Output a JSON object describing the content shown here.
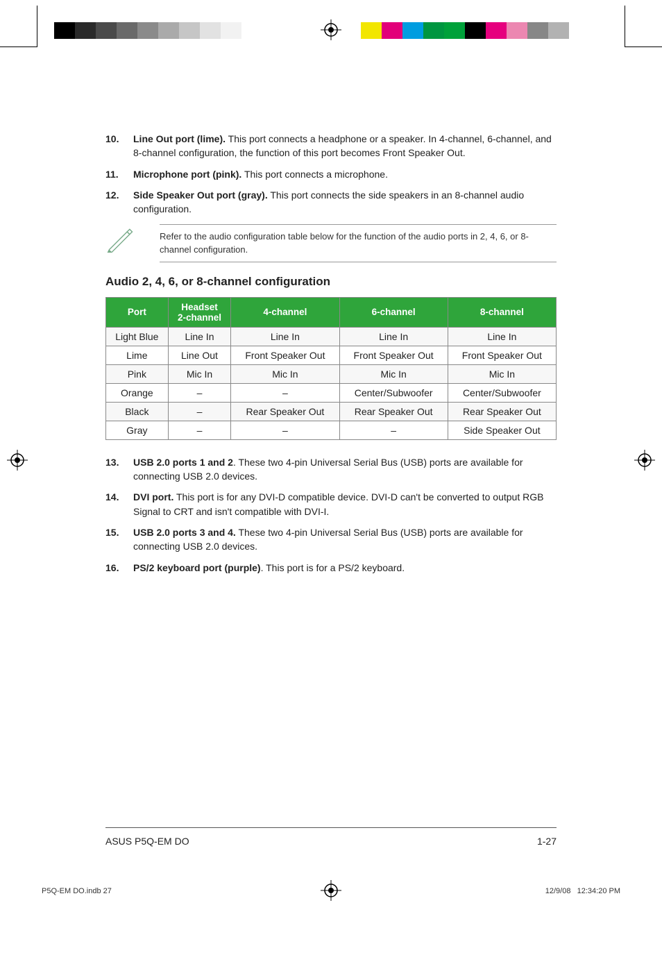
{
  "printer_marks": {
    "gray_swatches": [
      "#000000",
      "#2a2a2a",
      "#4a4a4a",
      "#6a6a6a",
      "#8a8a8a",
      "#aaaaaa",
      "#c6c6c6",
      "#e2e2e2",
      "#f2f2f2",
      "#ffffff"
    ],
    "color_swatches": [
      "#f2e600",
      "#e20079",
      "#009de0",
      "#009640",
      "#00a13a",
      "#000000",
      "#e6007e",
      "#ec87b1",
      "#878787",
      "#b2b2b2"
    ]
  },
  "list1": [
    {
      "num": "10.",
      "bold": "Line Out port (lime).",
      "rest": " This port connects a headphone or a speaker. In 4-channel, 6-channel, and 8-channel configuration, the function of this port becomes Front Speaker Out."
    },
    {
      "num": "11.",
      "bold": "Microphone port (pink).",
      "rest": " This port connects a microphone."
    },
    {
      "num": "12.",
      "bold": "Side Speaker Out port (gray).",
      "rest": " This port connects the side speakers in an 8-channel audio configuration."
    }
  ],
  "note": "Refer to the audio configuration table below for the function of the audio ports in 2, 4, 6, or 8-channel configuration.",
  "section_title": "Audio 2, 4, 6, or 8-channel configuration",
  "chart_data": {
    "type": "table",
    "headers": [
      "Port",
      "Headset 2-channel",
      "4-channel",
      "6-channel",
      "8-channel"
    ],
    "rows": [
      [
        "Light Blue",
        "Line In",
        "Line In",
        "Line In",
        "Line In"
      ],
      [
        "Lime",
        "Line Out",
        "Front Speaker Out",
        "Front Speaker Out",
        "Front Speaker Out"
      ],
      [
        "Pink",
        "Mic In",
        "Mic In",
        "Mic In",
        "Mic In"
      ],
      [
        "Orange",
        "–",
        "–",
        "Center/Subwoofer",
        "Center/Subwoofer"
      ],
      [
        "Black",
        "–",
        "Rear Speaker Out",
        "Rear Speaker Out",
        "Rear Speaker Out"
      ],
      [
        "Gray",
        "–",
        "–",
        "–",
        "Side Speaker Out"
      ]
    ]
  },
  "list2": [
    {
      "num": "13.",
      "bold": "USB 2.0 ports 1 and 2",
      "rest": ". These two 4-pin Universal Serial Bus (USB) ports are available for connecting USB 2.0 devices."
    },
    {
      "num": "14.",
      "bold": "DVI port.",
      "rest": " This port is for any DVI-D compatible device. DVI-D can't be converted to output RGB Signal to CRT and isn't compatible with DVI-I."
    },
    {
      "num": "15.",
      "bold": "USB 2.0 ports 3 and 4.",
      "rest": " These two 4-pin Universal Serial Bus (USB) ports are available for connecting USB 2.0 devices."
    },
    {
      "num": "16.",
      "bold": "PS/2 keyboard port (purple)",
      "rest": ". This port is for a PS/2 keyboard."
    }
  ],
  "footer": {
    "left": "ASUS P5Q-EM DO",
    "right": "1-27"
  },
  "meta": {
    "left": "P5Q-EM DO.indb   27",
    "right_date": "12/9/08",
    "right_time": "12:34:20 PM"
  }
}
